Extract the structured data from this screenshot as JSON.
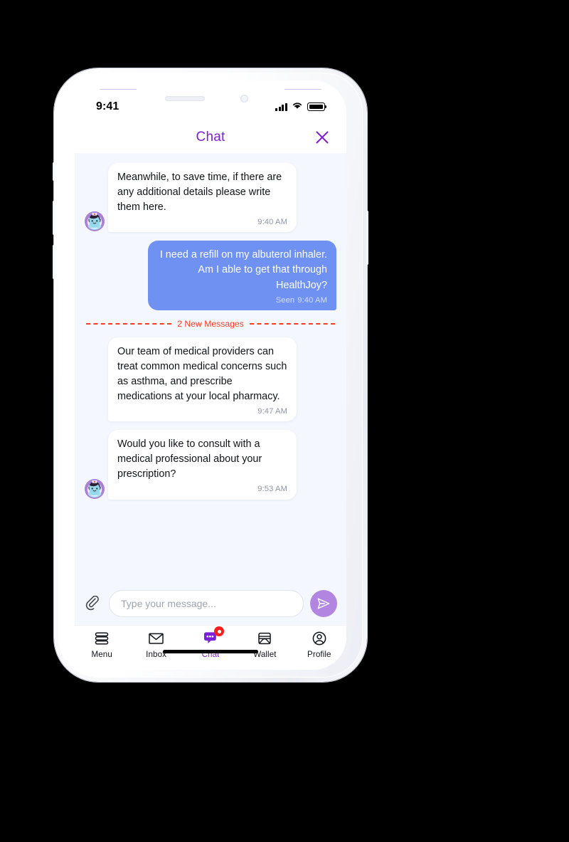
{
  "status_bar": {
    "time": "9:41",
    "signal_icon": "cellular-signal-icon",
    "wifi_icon": "wifi-icon",
    "battery_icon": "battery-full-icon"
  },
  "header": {
    "title": "Chat",
    "close_icon": "close-x-icon",
    "title_color": "#7d1fd2"
  },
  "conversation": {
    "new_messages_divider": "2 New Messages",
    "messages": [
      {
        "id": "msg-1",
        "direction": "incoming",
        "sender": "nurse-avatar",
        "show_avatar": true,
        "text": "Meanwhile, to save time, if there are any additional details please write them here.",
        "time": "9:40 AM",
        "status": ""
      },
      {
        "id": "msg-2",
        "direction": "outgoing",
        "sender": "user",
        "show_avatar": false,
        "text": "I need a refill on my albuterol inhaler. Am I able to get that through HealthJoy?",
        "time": "9:40 AM",
        "status": "Seen"
      },
      {
        "id": "msg-3",
        "direction": "incoming",
        "sender": "nurse-avatar",
        "show_avatar": false,
        "text": "Our team of medical providers can treat common medical concerns such as asthma, and prescribe medications at your local pharmacy.",
        "time": "9:47 AM",
        "status": ""
      },
      {
        "id": "msg-4",
        "direction": "incoming",
        "sender": "nurse-avatar",
        "show_avatar": true,
        "text": "Would you like to consult with a medical professional about your prescription?",
        "time": "9:53 AM",
        "status": ""
      }
    ]
  },
  "composer": {
    "attach_icon": "paperclip-icon",
    "input_value": "",
    "input_placeholder": "Type your message...",
    "send_icon": "send-paper-plane-icon",
    "send_color": "#b185e0"
  },
  "tabbar": {
    "items": [
      {
        "id": "menu",
        "label": "Menu",
        "icon": "menu-stacked-bars-icon",
        "active": false,
        "badge": ""
      },
      {
        "id": "inbox",
        "label": "Inbox",
        "icon": "envelope-icon",
        "active": false,
        "badge": ""
      },
      {
        "id": "chat",
        "label": "Chat",
        "icon": "chat-bubble-icon",
        "active": true,
        "badge": "dot"
      },
      {
        "id": "wallet",
        "label": "Wallet",
        "icon": "wallet-icon",
        "active": false,
        "badge": ""
      },
      {
        "id": "profile",
        "label": "Profile",
        "icon": "user-circle-icon",
        "active": false,
        "badge": ""
      }
    ],
    "active_color": "#8328d4",
    "badge_color": "#fa1f1f"
  },
  "colors": {
    "chat_background": "#f4f7fd",
    "incoming_bubble": "#ffffff",
    "outgoing_bubble": "#6f92f2",
    "divider_red": "#fa3c22",
    "brand_purple": "#7d1fd2"
  }
}
